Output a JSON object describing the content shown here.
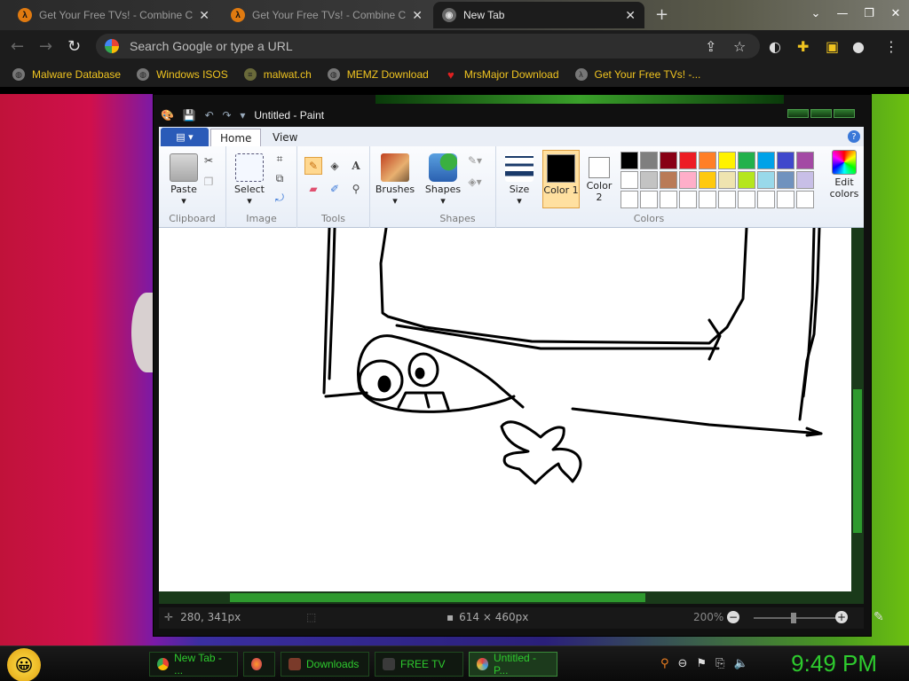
{
  "browser": {
    "tabs": [
      {
        "title": "Get Your Free TVs! - Combine C",
        "icon": "half-life-icon",
        "active": false
      },
      {
        "title": "Get Your Free TVs! - Combine C",
        "icon": "half-life-icon",
        "active": false
      },
      {
        "title": "New Tab",
        "icon": "chrome-icon",
        "active": true
      }
    ],
    "omnibox": {
      "placeholder": "Search Google or type a URL",
      "value": ""
    },
    "bookmarks": [
      {
        "label": "Malware Database",
        "icon": "globe-icon"
      },
      {
        "label": "Windows ISOS",
        "icon": "globe-icon"
      },
      {
        "label": "malwat.ch",
        "icon": "ladder-icon"
      },
      {
        "label": "MEMZ Download",
        "icon": "globe-icon"
      },
      {
        "label": "MrsMajor Download",
        "icon": "heart-icon"
      },
      {
        "label": "Get Your Free TVs! -...",
        "icon": "half-life-icon"
      }
    ]
  },
  "paint": {
    "title": "Untitled - Paint",
    "tabs": {
      "home": "Home",
      "view": "View"
    },
    "groups": {
      "clipboard": "Clipboard",
      "image": "Image",
      "tools": "Tools",
      "shapes": "Shapes",
      "colors": "Colors"
    },
    "buttons": {
      "paste": "Paste",
      "select": "Select",
      "brushes": "Brushes",
      "shapes": "Shapes",
      "size": "Size",
      "color1": "Color 1",
      "color2": "Color 2",
      "edit_colors": "Edit colors"
    },
    "color1": "#000000",
    "color2": "#ffffff",
    "palette": [
      "#000000",
      "#7f7f7f",
      "#880015",
      "#ed1c24",
      "#ff7f27",
      "#fff200",
      "#22b14c",
      "#00a2e8",
      "#3f48cc",
      "#a349a4",
      "#ffffff",
      "#c3c3c3",
      "#b97a57",
      "#ffaec9",
      "#ffc90e",
      "#efe4b0",
      "#b5e61d",
      "#99d9ea",
      "#7092be",
      "#c8bfe7",
      "#ffffff",
      "#ffffff",
      "#ffffff",
      "#ffffff",
      "#ffffff",
      "#ffffff",
      "#ffffff",
      "#ffffff",
      "#ffffff",
      "#ffffff"
    ],
    "status": {
      "cursor": "280, 341px",
      "dimensions": "614 × 460px",
      "zoom": "200%"
    }
  },
  "taskbar": {
    "items": [
      {
        "label": "New Tab - ...",
        "icon": "chrome-icon"
      },
      {
        "label": "",
        "icon": "firefox-icon"
      },
      {
        "label": "Downloads",
        "icon": "folder-icon"
      },
      {
        "label": "FREE TV",
        "icon": "app-icon"
      },
      {
        "label": "Untitled - P...",
        "icon": "paint-icon"
      }
    ],
    "clock": "9:49 PM"
  }
}
